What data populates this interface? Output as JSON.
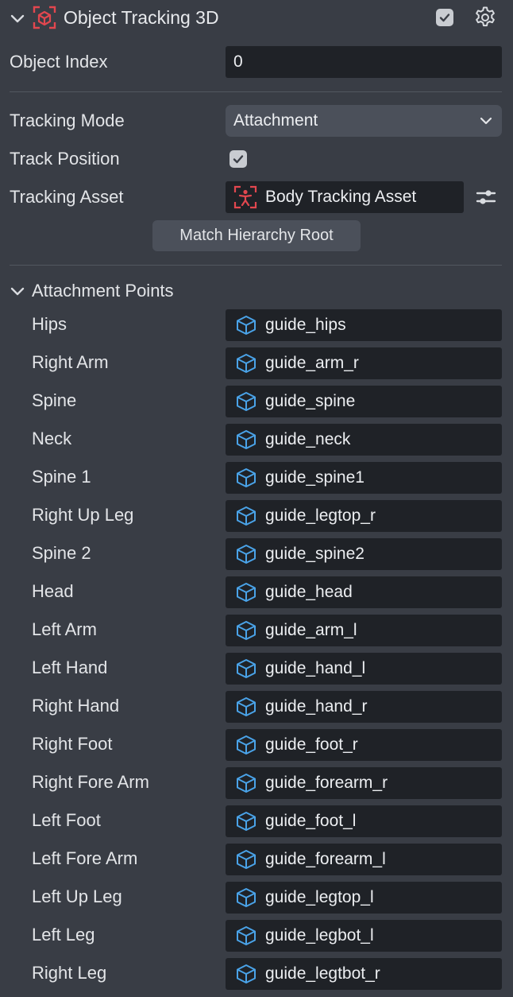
{
  "header": {
    "title": "Object Tracking 3D",
    "enabled": true,
    "component_icon": "object-tracker-icon",
    "settings_icon": "gear-icon"
  },
  "fields": {
    "object_index_label": "Object Index",
    "object_index_value": "0",
    "tracking_mode_label": "Tracking Mode",
    "tracking_mode_value": "Attachment",
    "track_position_label": "Track Position",
    "track_position_checked": true,
    "tracking_asset_label": "Tracking Asset",
    "tracking_asset_value": "Body Tracking Asset",
    "match_hierarchy_button": "Match Hierarchy Root"
  },
  "attachment": {
    "section_title": "Attachment Points",
    "points": [
      {
        "label": "Hips",
        "value": "guide_hips"
      },
      {
        "label": "Right Arm",
        "value": "guide_arm_r"
      },
      {
        "label": "Spine",
        "value": "guide_spine"
      },
      {
        "label": "Neck",
        "value": "guide_neck"
      },
      {
        "label": "Spine 1",
        "value": "guide_spine1"
      },
      {
        "label": "Right Up Leg",
        "value": "guide_legtop_r"
      },
      {
        "label": "Spine 2",
        "value": "guide_spine2"
      },
      {
        "label": "Head",
        "value": "guide_head"
      },
      {
        "label": "Left Arm",
        "value": "guide_arm_l"
      },
      {
        "label": "Left Hand",
        "value": "guide_hand_l"
      },
      {
        "label": "Right Hand",
        "value": "guide_hand_r"
      },
      {
        "label": "Right Foot",
        "value": "guide_foot_r"
      },
      {
        "label": "Right Fore Arm",
        "value": "guide_forearm_r"
      },
      {
        "label": "Left Foot",
        "value": "guide_foot_l"
      },
      {
        "label": "Left Fore Arm",
        "value": "guide_forearm_l"
      },
      {
        "label": "Left Up Leg",
        "value": "guide_legtop_l"
      },
      {
        "label": "Left Leg",
        "value": "guide_legbot_l"
      },
      {
        "label": "Right Leg",
        "value": "guide_legtbot_r"
      }
    ]
  },
  "colors": {
    "panel_bg": "#393d45",
    "field_bg": "#1f2227",
    "accent_blue": "#4aa3e8",
    "accent_red": "#e2474f"
  }
}
